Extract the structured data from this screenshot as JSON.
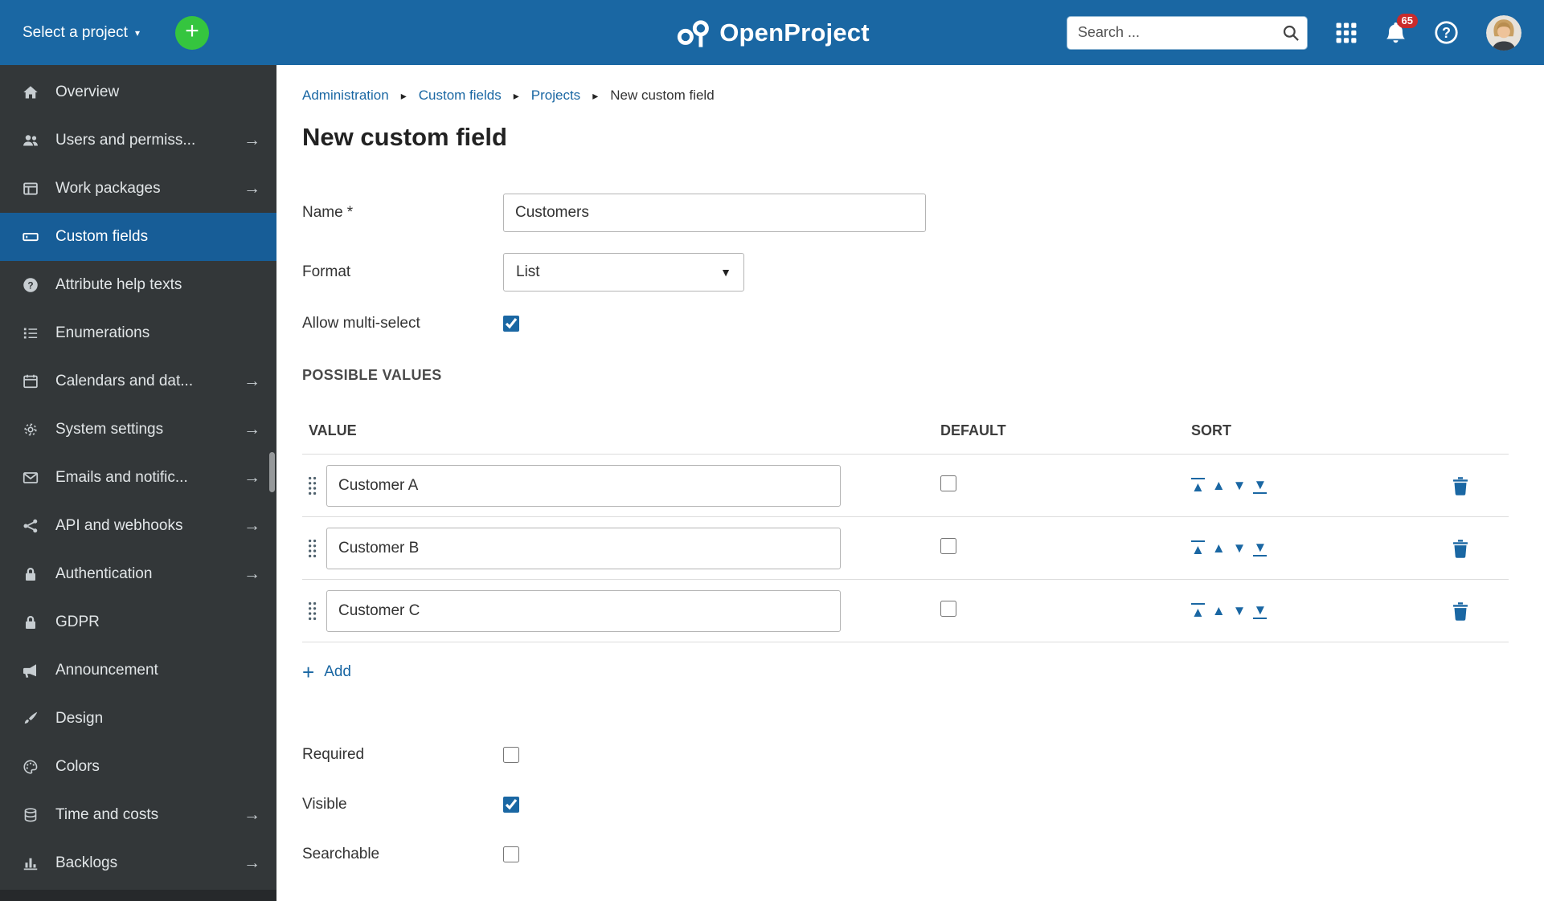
{
  "topbar": {
    "project_selector_label": "Select a project",
    "brand_name": "OpenProject",
    "search_placeholder": "Search ...",
    "notification_count": "65"
  },
  "breadcrumb": {
    "items": [
      "Administration",
      "Custom fields",
      "Projects",
      "New custom field"
    ]
  },
  "sidebar": {
    "items": [
      {
        "label": "Overview",
        "icon": "home",
        "has_submenu": false,
        "active": false
      },
      {
        "label": "Users and permiss...",
        "icon": "users",
        "has_submenu": true,
        "active": false
      },
      {
        "label": "Work packages",
        "icon": "work-packages",
        "has_submenu": true,
        "active": false
      },
      {
        "label": "Custom fields",
        "icon": "custom-fields",
        "has_submenu": false,
        "active": true
      },
      {
        "label": "Attribute help texts",
        "icon": "question-circle",
        "has_submenu": false,
        "active": false
      },
      {
        "label": "Enumerations",
        "icon": "list",
        "has_submenu": false,
        "active": false
      },
      {
        "label": "Calendars and dat...",
        "icon": "calendar",
        "has_submenu": true,
        "active": false
      },
      {
        "label": "System settings",
        "icon": "gear",
        "has_submenu": true,
        "active": false
      },
      {
        "label": "Emails and notific...",
        "icon": "mail",
        "has_submenu": true,
        "active": false
      },
      {
        "label": "API and webhooks",
        "icon": "nodes",
        "has_submenu": true,
        "active": false
      },
      {
        "label": "Authentication",
        "icon": "lock",
        "has_submenu": true,
        "active": false
      },
      {
        "label": "GDPR",
        "icon": "lock",
        "has_submenu": false,
        "active": false
      },
      {
        "label": "Announcement",
        "icon": "megaphone",
        "has_submenu": false,
        "active": false
      },
      {
        "label": "Design",
        "icon": "paintbrush",
        "has_submenu": false,
        "active": false
      },
      {
        "label": "Colors",
        "icon": "palette",
        "has_submenu": false,
        "active": false
      },
      {
        "label": "Time and costs",
        "icon": "coins",
        "has_submenu": true,
        "active": false
      },
      {
        "label": "Backlogs",
        "icon": "chart-bars",
        "has_submenu": true,
        "active": false
      }
    ]
  },
  "page": {
    "title": "New custom field"
  },
  "form": {
    "name": {
      "label": "Name",
      "required_mark": "*",
      "value": "Customers"
    },
    "format": {
      "label": "Format",
      "value": "List"
    },
    "multi_select": {
      "label": "Allow multi-select",
      "checked": true
    },
    "possible_values": {
      "section_title": "POSSIBLE VALUES",
      "columns": {
        "value": "VALUE",
        "default": "DEFAULT",
        "sort": "SORT"
      },
      "rows": [
        {
          "value": "Customer A",
          "default_checked": false
        },
        {
          "value": "Customer B",
          "default_checked": false
        },
        {
          "value": "Customer C",
          "default_checked": false
        }
      ],
      "add_label": "Add"
    },
    "required": {
      "label": "Required",
      "checked": false
    },
    "visible": {
      "label": "Visible",
      "checked": true
    },
    "searchable": {
      "label": "Searchable",
      "checked": false
    }
  },
  "colors": {
    "accent": "#1a67a3",
    "topbar_bg": "#1a67a3",
    "sidebar_bg": "#333739",
    "sidebar_active_bg": "#175d97",
    "badge_bg": "#c92b2b",
    "add_button_bg": "#35c53f"
  }
}
